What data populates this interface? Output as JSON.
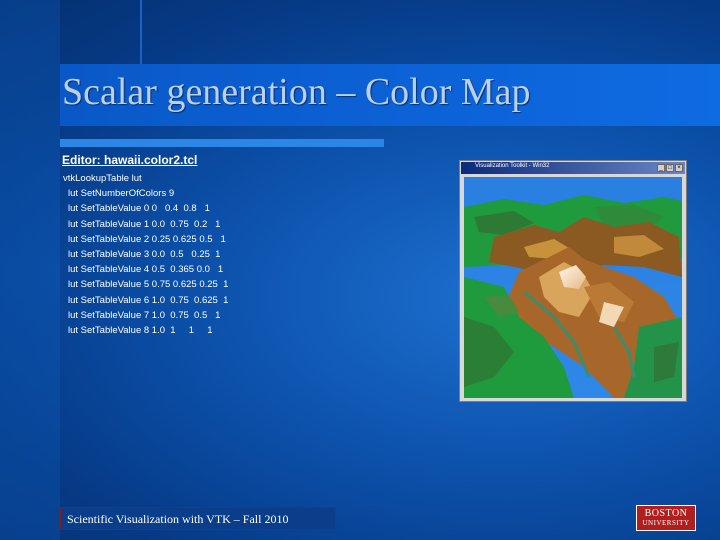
{
  "slide": {
    "title": "Scalar generation – Color Map",
    "editor_label": "Editor: hawaii.color2.tcl",
    "code_lines": [
      "vtkLookupTable lut",
      "lut SetNumberOfColors 9",
      "lut SetTableValue 0 0   0.4  0.8   1",
      "lut SetTableValue 1 0.0  0.75  0.2   1",
      "lut SetTableValue 2 0.25 0.625 0.5   1",
      "lut SetTableValue 3 0.0  0.5   0.25  1",
      "lut SetTableValue 4 0.5  0.365 0.0   1",
      "lut SetTableValue 5 0.75 0.625 0.25  1",
      "lut SetTableValue 6 1.0  0.75  0.625  1",
      "lut SetTableValue 7 1.0  0.75  0.5   1",
      "lut SetTableValue 8 1.0  1     1     1"
    ],
    "render_window": {
      "title": "Visualization Toolkit - Win32"
    },
    "footer": "Scientific Visualization with VTK – Fall 2010",
    "logo": {
      "line1": "BOSTON",
      "line2": "UNIVERSITY"
    }
  },
  "colors": {
    "background": "#0b4fa8",
    "title_bar": "#0c63d8",
    "accent_bar": "#2b86e6",
    "logo_red": "#b01e1e"
  }
}
